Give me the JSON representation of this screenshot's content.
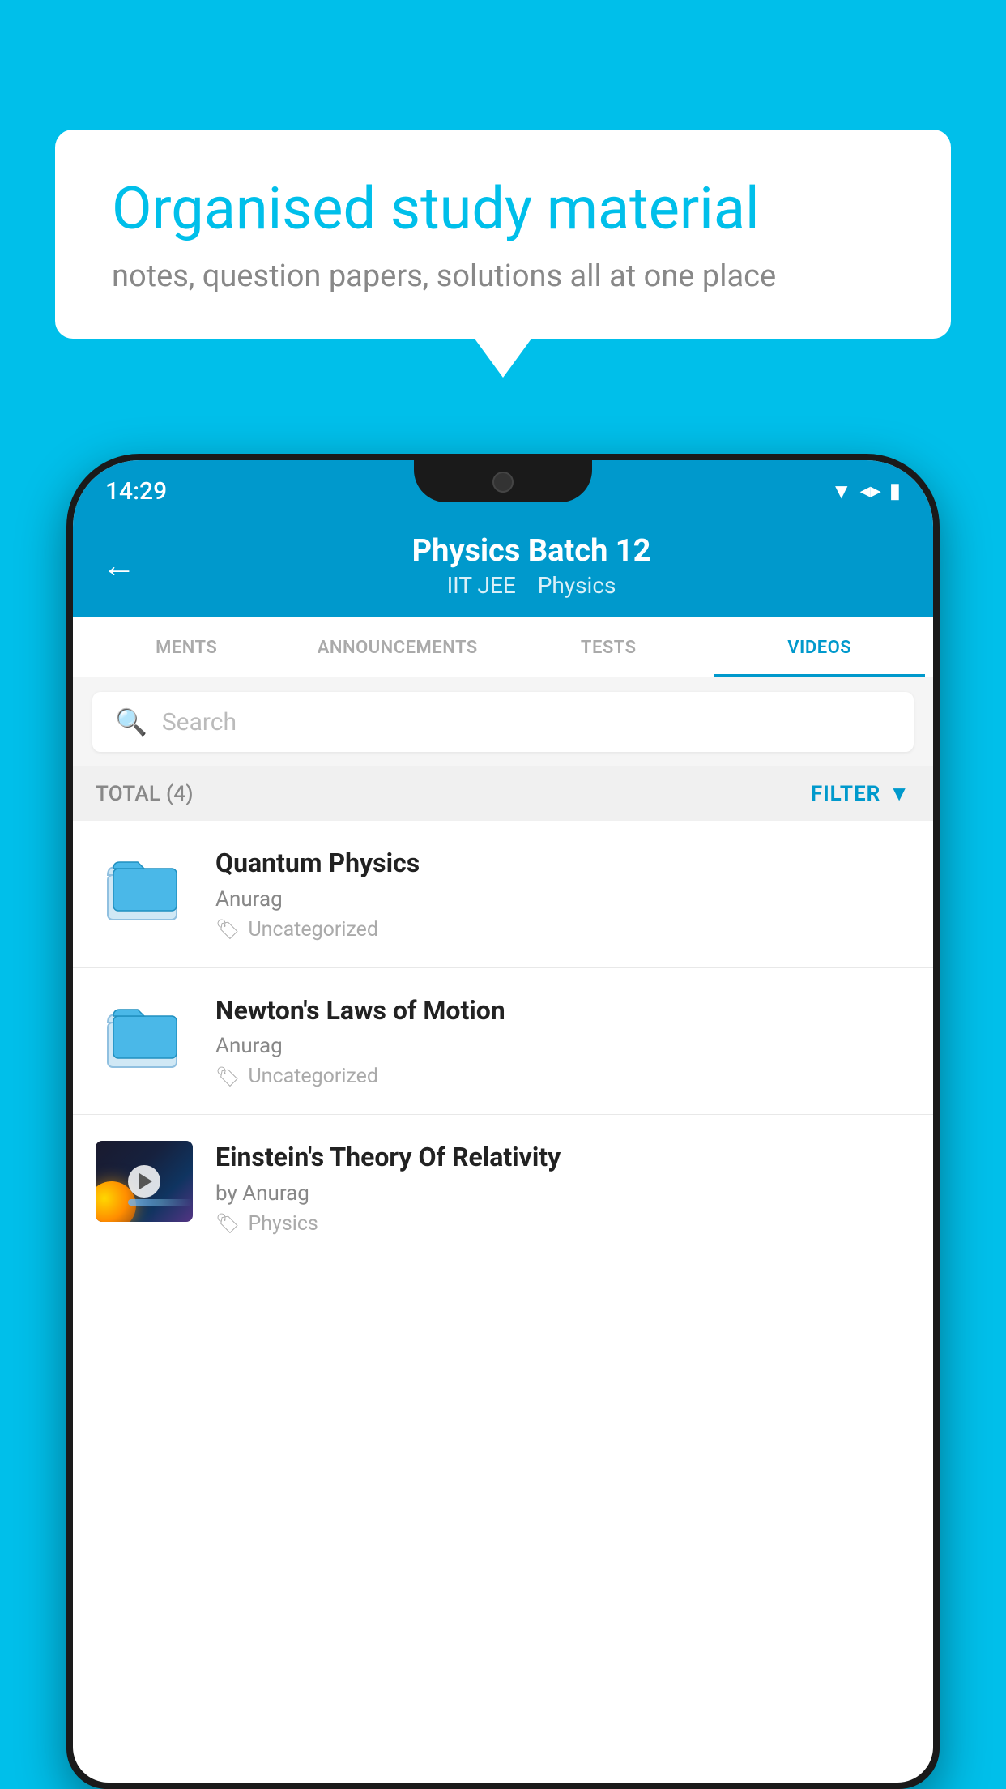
{
  "background_color": "#00BFEA",
  "bubble": {
    "title": "Organised study material",
    "subtitle": "notes, question papers, solutions all at one place"
  },
  "phone": {
    "status_bar": {
      "time": "14:29",
      "icons": [
        "wifi",
        "signal",
        "battery"
      ]
    },
    "header": {
      "back_label": "←",
      "title": "Physics Batch 12",
      "tag1": "IIT JEE",
      "tag2": "Physics"
    },
    "tabs": [
      {
        "label": "MENTS",
        "active": false
      },
      {
        "label": "ANNOUNCEMENTS",
        "active": false
      },
      {
        "label": "TESTS",
        "active": false
      },
      {
        "label": "VIDEOS",
        "active": true
      }
    ],
    "search": {
      "placeholder": "Search"
    },
    "filter_bar": {
      "total_label": "TOTAL (4)",
      "filter_label": "FILTER"
    },
    "videos": [
      {
        "title": "Quantum Physics",
        "author": "Anurag",
        "tag": "Uncategorized",
        "type": "folder"
      },
      {
        "title": "Newton's Laws of Motion",
        "author": "Anurag",
        "tag": "Uncategorized",
        "type": "folder"
      },
      {
        "title": "Einstein's Theory Of Relativity",
        "author": "by Anurag",
        "tag": "Physics",
        "type": "video"
      }
    ]
  }
}
